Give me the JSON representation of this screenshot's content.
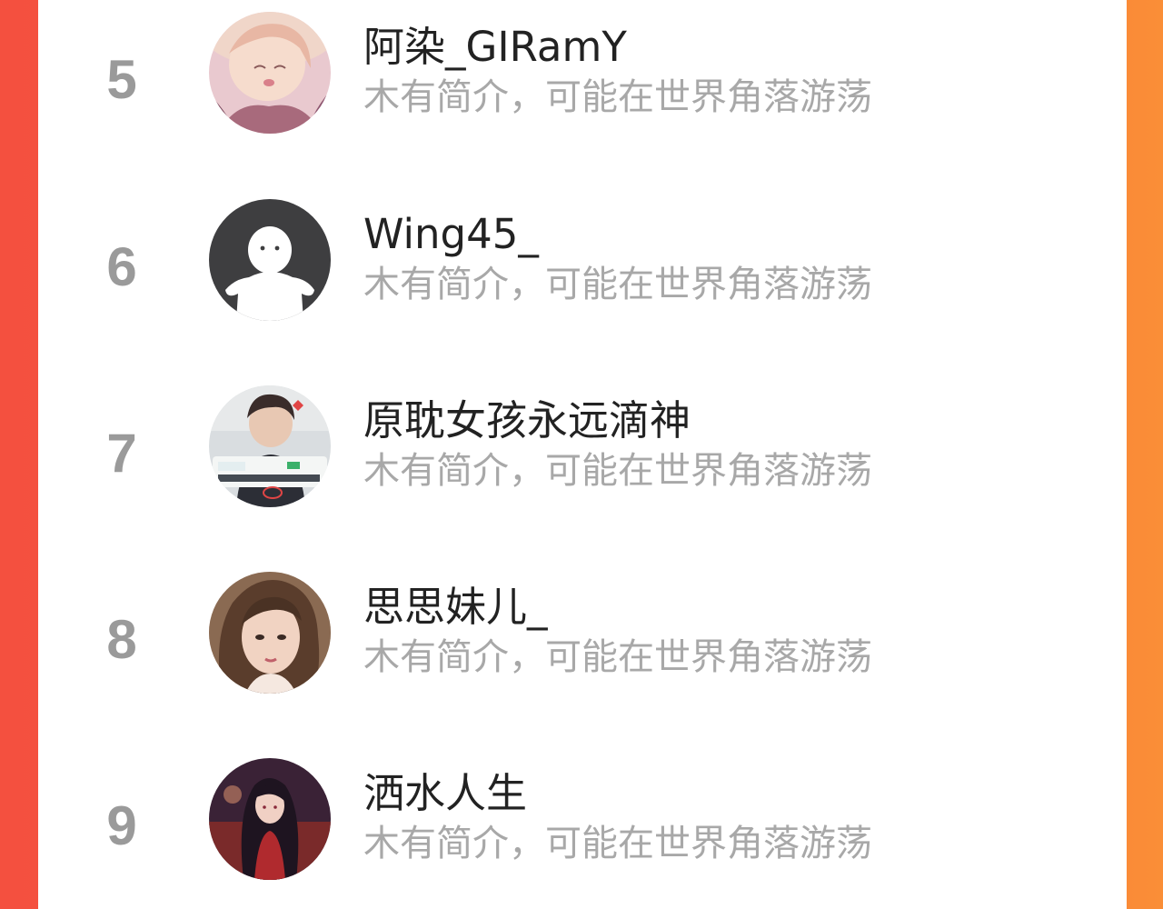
{
  "colors": {
    "background_left": "#f4503f",
    "background_right": "#fa8e37",
    "card": "#ffffff",
    "rank_text": "#9a9a9a",
    "name_text": "#222222",
    "bio_text": "#a8a8a8"
  },
  "ranking": [
    {
      "rank": "5",
      "name": "阿染_GIRamY",
      "bio": "木有简介，可能在世界角落游荡",
      "avatar": "anime-girl-avatar"
    },
    {
      "rank": "6",
      "name": "Wing45_",
      "bio": "木有简介，可能在世界角落游荡",
      "avatar": "default-avatar"
    },
    {
      "rank": "7",
      "name": "原耽女孩永远滴神",
      "bio": "木有简介，可能在世界角落游荡",
      "avatar": "photo-avatar"
    },
    {
      "rank": "8",
      "name": "思思妹儿_",
      "bio": "木有简介，可能在世界角落游荡",
      "avatar": "photo-avatar"
    },
    {
      "rank": "9",
      "name": "洒水人生",
      "bio": "木有简介，可能在世界角落游荡",
      "avatar": "anime-girl-avatar"
    }
  ]
}
